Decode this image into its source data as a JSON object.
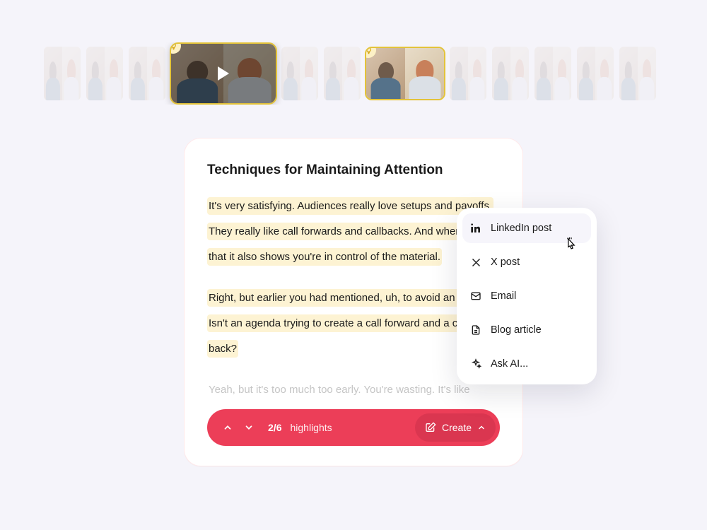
{
  "timeline": {
    "main_selected_index": 3,
    "secondary_selected_index": 7
  },
  "card": {
    "title": "Techniques for Maintaining Attention",
    "paragraphs": [
      "It's very satisfying. Audiences really love setups and payoffs. They really like call forwards and callbacks. And when you do that it also shows you're in control of the material.",
      "Right, but earlier you had mentioned, uh, to avoid an agenda. Isn't an agenda trying to create a call forward and a call back?",
      "Yeah, but it's too much too early. You're wasting. It's like"
    ]
  },
  "pill": {
    "current": "2",
    "total": "6",
    "highlights_label": "highlights",
    "create_label": "Create"
  },
  "menu": {
    "items": [
      {
        "icon": "linkedin",
        "label": "LinkedIn post"
      },
      {
        "icon": "x",
        "label": "X post"
      },
      {
        "icon": "email",
        "label": "Email"
      },
      {
        "icon": "blog",
        "label": "Blog article"
      },
      {
        "icon": "ai",
        "label": "Ask AI..."
      }
    ]
  }
}
